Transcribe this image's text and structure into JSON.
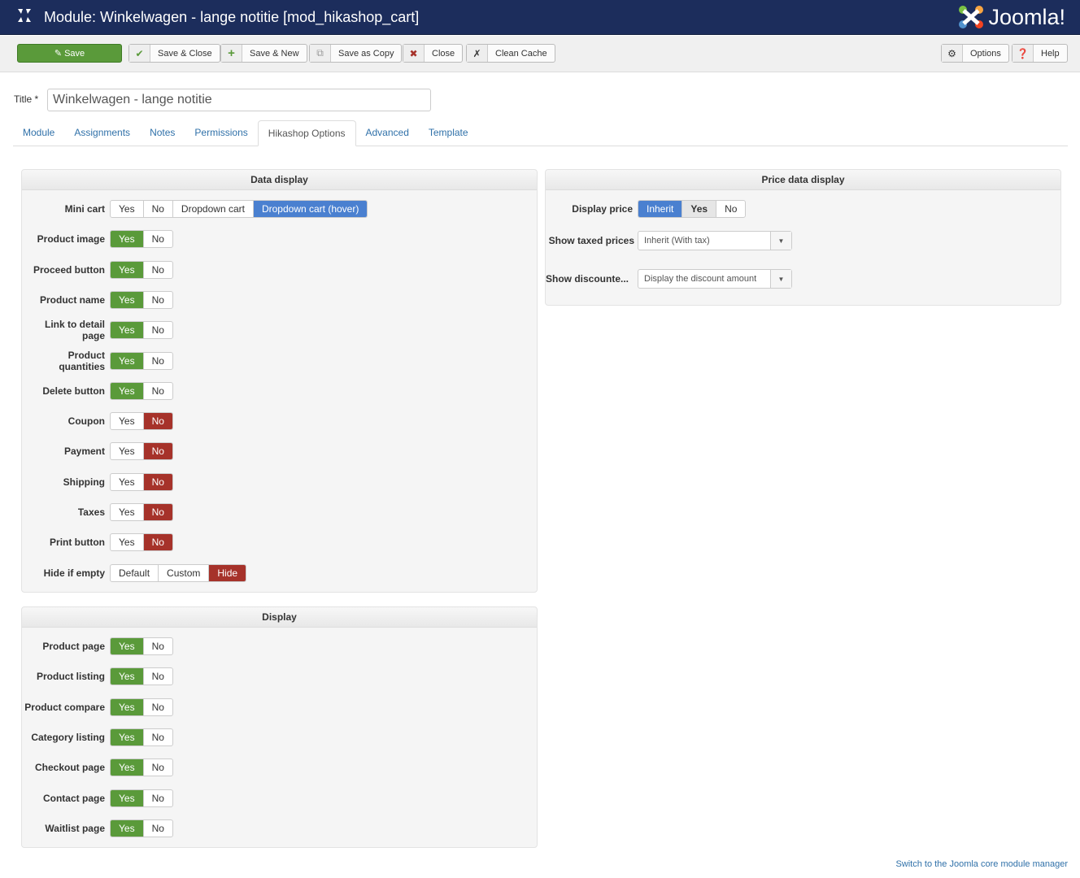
{
  "header": {
    "title": "Module: Winkelwagen - lange notitie [mod_hikashop_cart]",
    "logo": "Joomla!"
  },
  "toolbar": {
    "save": "Save",
    "save_close": "Save & Close",
    "save_new": "Save & New",
    "save_copy": "Save as Copy",
    "close": "Close",
    "clean_cache": "Clean Cache",
    "options": "Options",
    "help": "Help"
  },
  "title": {
    "label": "Title *",
    "value": "Winkelwagen - lange notitie"
  },
  "tabs": [
    "Module",
    "Assignments",
    "Notes",
    "Permissions",
    "Hikashop Options",
    "Advanced",
    "Template"
  ],
  "active_tab": "Hikashop Options",
  "data_display": {
    "heading": "Data display",
    "rows": [
      {
        "label": "Mini cart",
        "options": [
          "Yes",
          "No",
          "Dropdown cart",
          "Dropdown cart (hover)"
        ],
        "selected": 3,
        "color": "blue"
      },
      {
        "label": "Product image",
        "options": [
          "Yes",
          "No"
        ],
        "selected": 0,
        "color": "green"
      },
      {
        "label": "Proceed button",
        "options": [
          "Yes",
          "No"
        ],
        "selected": 0,
        "color": "green"
      },
      {
        "label": "Product name",
        "options": [
          "Yes",
          "No"
        ],
        "selected": 0,
        "color": "green"
      },
      {
        "label": "Link to detail page",
        "options": [
          "Yes",
          "No"
        ],
        "selected": 0,
        "color": "green"
      },
      {
        "label": "Product quantities",
        "options": [
          "Yes",
          "No"
        ],
        "selected": 0,
        "color": "green"
      },
      {
        "label": "Delete button",
        "options": [
          "Yes",
          "No"
        ],
        "selected": 0,
        "color": "green"
      },
      {
        "label": "Coupon",
        "options": [
          "Yes",
          "No"
        ],
        "selected": 1,
        "color": "red"
      },
      {
        "label": "Payment",
        "options": [
          "Yes",
          "No"
        ],
        "selected": 1,
        "color": "red"
      },
      {
        "label": "Shipping",
        "options": [
          "Yes",
          "No"
        ],
        "selected": 1,
        "color": "red"
      },
      {
        "label": "Taxes",
        "options": [
          "Yes",
          "No"
        ],
        "selected": 1,
        "color": "red"
      },
      {
        "label": "Print button",
        "options": [
          "Yes",
          "No"
        ],
        "selected": 1,
        "color": "red"
      },
      {
        "label": "Hide if empty",
        "options": [
          "Default",
          "Custom",
          "Hide"
        ],
        "selected": 2,
        "color": "red"
      }
    ]
  },
  "display": {
    "heading": "Display",
    "rows": [
      {
        "label": "Product page",
        "options": [
          "Yes",
          "No"
        ],
        "selected": 0,
        "color": "green"
      },
      {
        "label": "Product listing",
        "options": [
          "Yes",
          "No"
        ],
        "selected": 0,
        "color": "green"
      },
      {
        "label": "Product compare",
        "options": [
          "Yes",
          "No"
        ],
        "selected": 0,
        "color": "green"
      },
      {
        "label": "Category listing",
        "options": [
          "Yes",
          "No"
        ],
        "selected": 0,
        "color": "green"
      },
      {
        "label": "Checkout page",
        "options": [
          "Yes",
          "No"
        ],
        "selected": 0,
        "color": "green"
      },
      {
        "label": "Contact page",
        "options": [
          "Yes",
          "No"
        ],
        "selected": 0,
        "color": "green"
      },
      {
        "label": "Waitlist page",
        "options": [
          "Yes",
          "No"
        ],
        "selected": 0,
        "color": "green"
      }
    ]
  },
  "price_display": {
    "heading": "Price data display",
    "display_price": {
      "label": "Display price",
      "options": [
        "Inherit",
        "Yes",
        "No"
      ],
      "selected": 0
    },
    "taxed": {
      "label": "Show taxed prices",
      "value": "Inherit (With tax)"
    },
    "discount": {
      "label": "Show discounte...",
      "value": "Display the discount amount"
    }
  },
  "footer": {
    "link": "Switch to the Joomla core module manager"
  },
  "colors": {
    "header": "#1c2d5c",
    "green": "#5a9a3a",
    "red": "#a6322a",
    "blue": "#4a80d0"
  }
}
